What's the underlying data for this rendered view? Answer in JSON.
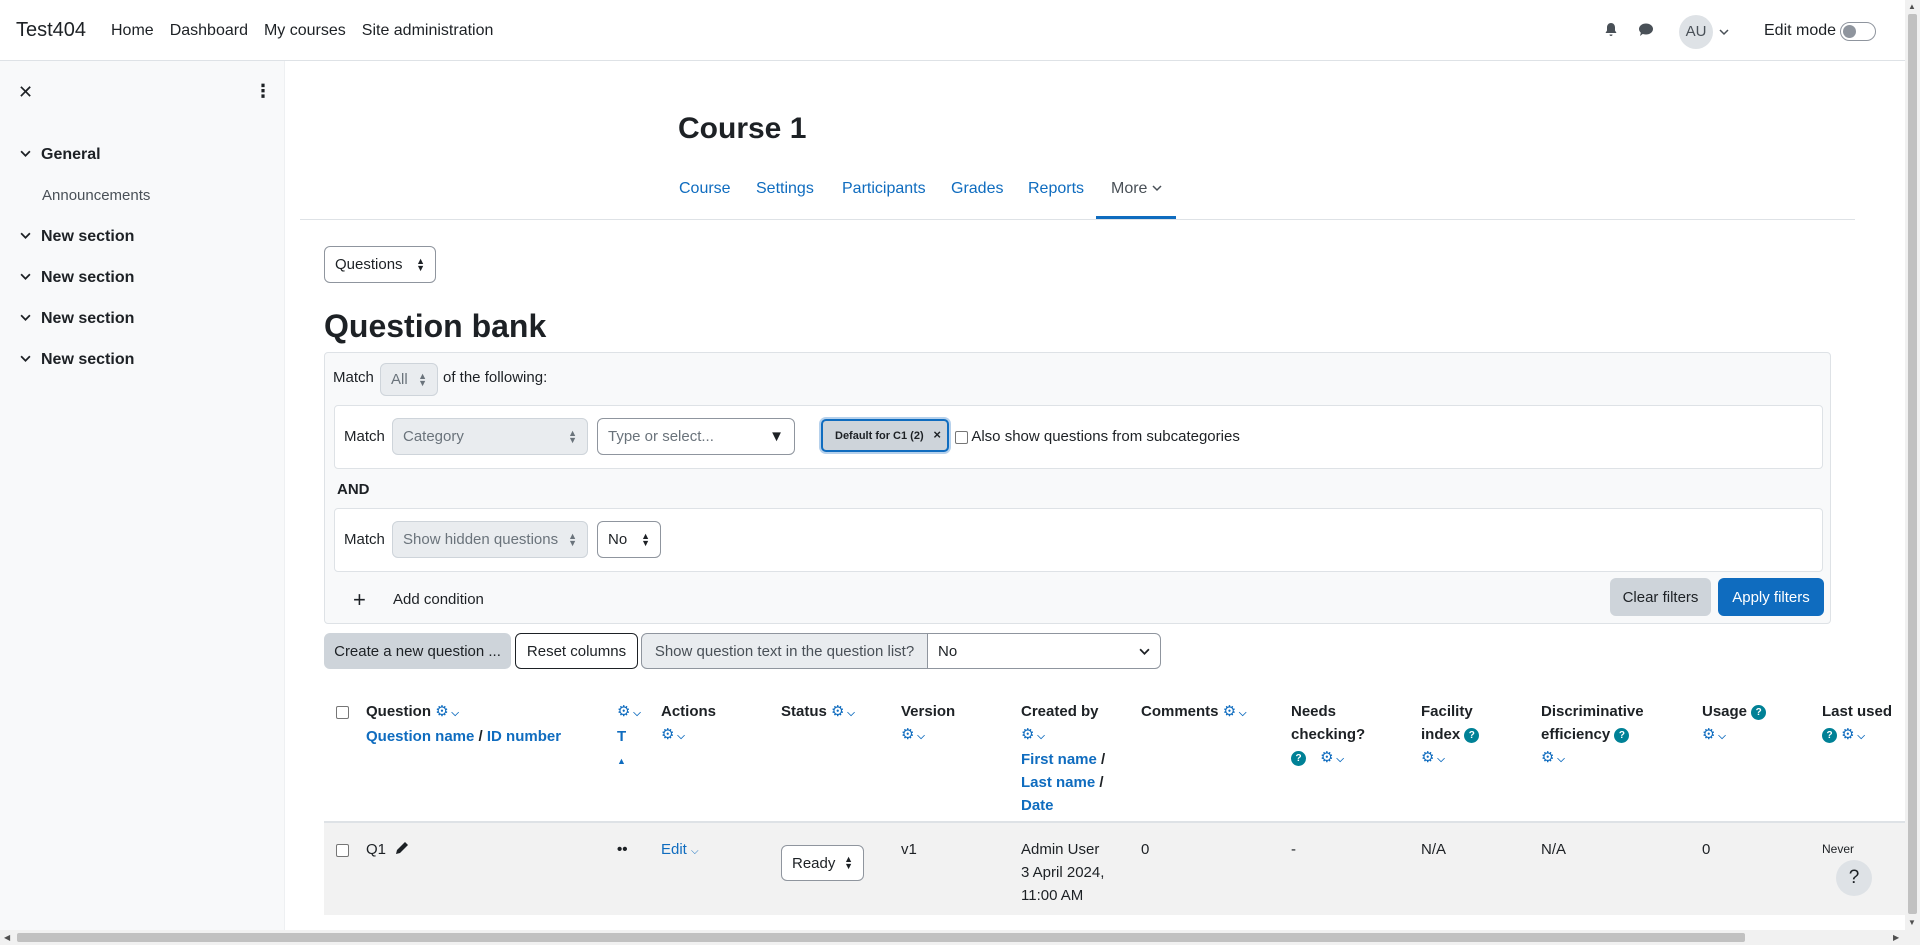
{
  "navbar": {
    "brand": "Test404",
    "links": [
      "Home",
      "Dashboard",
      "My courses",
      "Site administration"
    ],
    "avatar_initials": "AU",
    "edit_mode_label": "Edit mode"
  },
  "drawer": {
    "sections": [
      {
        "label": "General",
        "items": [
          "Announcements"
        ]
      },
      {
        "label": "New section",
        "items": []
      },
      {
        "label": "New section",
        "items": []
      },
      {
        "label": "New section",
        "items": []
      },
      {
        "label": "New section",
        "items": []
      }
    ]
  },
  "course": {
    "title": "Course 1",
    "tabs": [
      "Course",
      "Settings",
      "Participants",
      "Grades",
      "Reports",
      "More"
    ]
  },
  "page_select": "Questions",
  "question_bank": {
    "heading": "Question bank",
    "match_label": "Match",
    "match_value": "All",
    "of_following": "of the following:",
    "cond1": {
      "match": "Match",
      "type": "Category",
      "placeholder": "Type or select...",
      "chip": "Default for C1 (2)",
      "subcat_label": "Also show questions from subcategories"
    },
    "and_label": "AND",
    "cond2": {
      "match": "Match",
      "type": "Show hidden questions",
      "value": "No"
    },
    "add_condition": "Add condition",
    "clear_filters": "Clear filters",
    "apply_filters": "Apply filters"
  },
  "toolbar": {
    "create": "Create a new question ...",
    "reset": "Reset columns",
    "show_text_label": "Show question text in the question list?",
    "show_text_value": "No"
  },
  "table": {
    "headers": {
      "question": "Question",
      "question_name": "Question name",
      "id_number": "ID number",
      "t": "T",
      "actions": "Actions",
      "status": "Status",
      "version": "Version",
      "created_by": "Created by",
      "first_name": "First name",
      "last_name": "Last name",
      "date": "Date",
      "comments": "Comments",
      "needs1": "Needs",
      "needs2": "checking?",
      "facility1": "Facility",
      "facility2": "index",
      "disc1": "Discriminative",
      "disc2": "efficiency",
      "usage": "Usage",
      "last_used": "Last used"
    },
    "row": {
      "name": "Q1",
      "edit": "Edit",
      "status": "Ready",
      "version": "v1",
      "created_line1": "Admin User",
      "created_line2": "3 April 2024,",
      "created_line3": "11:00 AM",
      "comments": "0",
      "needs_checking": "-",
      "facility": "N/A",
      "discriminative": "N/A",
      "usage": "0",
      "last_used": "Never"
    }
  }
}
